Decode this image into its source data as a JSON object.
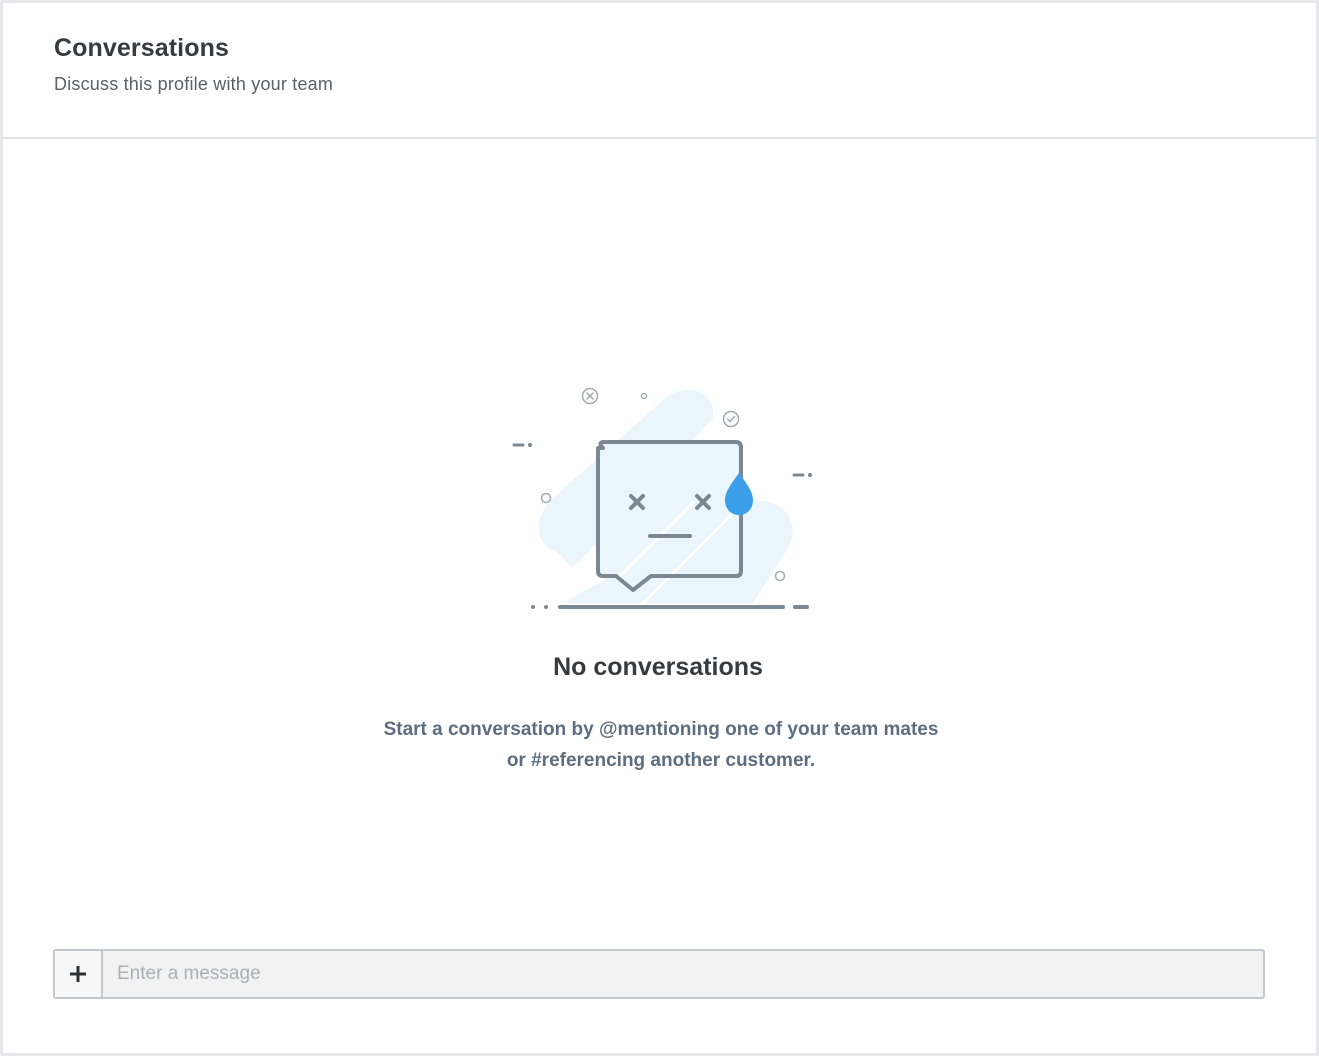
{
  "header": {
    "title": "Conversations",
    "subtitle": "Discuss this profile with your team"
  },
  "empty_state": {
    "illustration_icon": "sad-chat-bubble-icon",
    "title": "No conversations",
    "description": "Start a conversation by @mentioning one of your team mates or #referencing another customer."
  },
  "composer": {
    "add_icon": "plus-icon",
    "placeholder": "Enter a message",
    "value": ""
  },
  "colors": {
    "title_text": "#363b40",
    "description_text": "#5c6e80",
    "illustration_stroke": "#7b8891",
    "illustration_blob": "#eaf5fc",
    "tear_drop": "#3a9fe8",
    "border": "#dfe3e7"
  }
}
